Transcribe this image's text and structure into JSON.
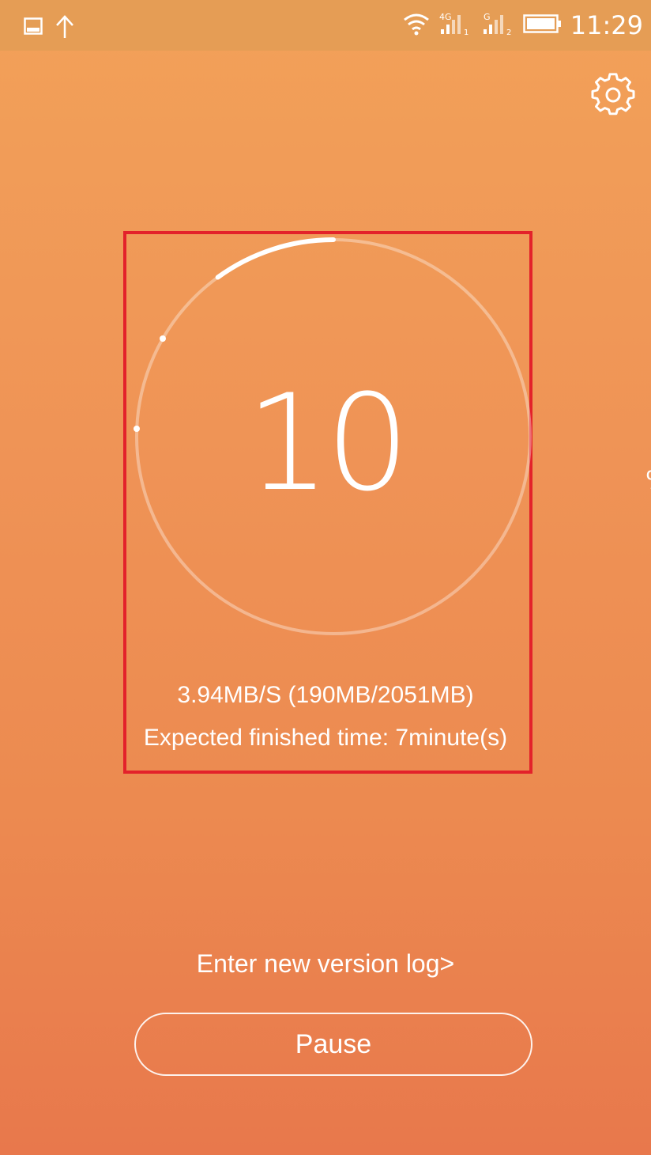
{
  "status_bar": {
    "time": "11:29",
    "left_icons": [
      "image-icon",
      "upload-arrow-icon"
    ],
    "right_icons": [
      "wifi-icon",
      "signal-4g-sim1-icon",
      "signal-g-sim2-icon",
      "battery-icon"
    ],
    "network_label_1": "4G",
    "network_label_2": "G",
    "sim_1": "1",
    "sim_2": "2"
  },
  "settings": {
    "icon": "gear-icon"
  },
  "progress": {
    "percent_value": "10",
    "percent_sign": "%",
    "fraction": 0.1,
    "speed_text": "3.94MB/S (190MB/2051MB)",
    "eta_text": "Expected finished time: 7minute(s)"
  },
  "actions": {
    "version_log_label": "Enter new version log>",
    "pause_label": "Pause"
  },
  "colors": {
    "gradient_top": "#f2a159",
    "gradient_bottom": "#e8784c",
    "status_bar": "#e59d55",
    "highlight_border": "#e3222a",
    "foreground": "#ffffff"
  }
}
